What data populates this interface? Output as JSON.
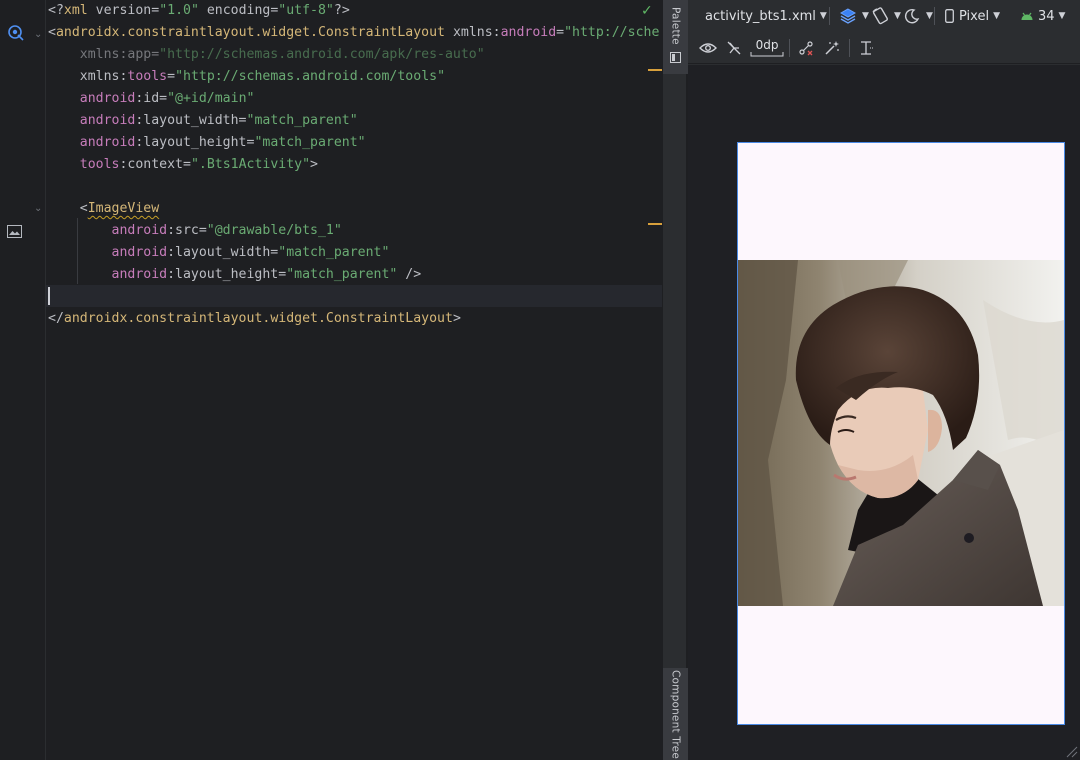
{
  "editor": {
    "lines": [
      {
        "segments": [
          [
            "punct",
            "<?"
          ],
          [
            "tag",
            "xml"
          ],
          [
            "attr",
            " version="
          ],
          [
            "str",
            "\"1.0\""
          ],
          [
            "attr",
            " encoding="
          ],
          [
            "str",
            "\"utf-8\""
          ],
          [
            "punct",
            "?>"
          ]
        ]
      },
      {
        "segments": [
          [
            "punct",
            "<"
          ],
          [
            "tag",
            "androidx.constraintlayout.widget.ConstraintLayout"
          ],
          [
            "attr",
            " xmlns:"
          ],
          [
            "ns",
            "android"
          ],
          [
            "attr",
            "="
          ],
          [
            "str",
            "\"http://sche"
          ]
        ]
      },
      {
        "segments": [
          [
            "attr",
            "    xmlns:app="
          ],
          [
            "str",
            "\"http://schemas.android.com/apk/res-auto\""
          ]
        ],
        "dim": true
      },
      {
        "segments": [
          [
            "attr",
            "    xmlns:"
          ],
          [
            "ns",
            "tools"
          ],
          [
            "attr",
            "="
          ],
          [
            "str",
            "\"http://schemas.android.com/tools\""
          ]
        ]
      },
      {
        "segments": [
          [
            "ns",
            "    android"
          ],
          [
            "attr",
            ":id="
          ],
          [
            "str",
            "\"@+id/main\""
          ]
        ]
      },
      {
        "segments": [
          [
            "ns",
            "    android"
          ],
          [
            "attr",
            ":layout_width="
          ],
          [
            "str",
            "\"match_parent\""
          ]
        ]
      },
      {
        "segments": [
          [
            "ns",
            "    android"
          ],
          [
            "attr",
            ":layout_height="
          ],
          [
            "str",
            "\"match_parent\""
          ]
        ]
      },
      {
        "segments": [
          [
            "ns",
            "    tools"
          ],
          [
            "attr",
            ":context="
          ],
          [
            "str",
            "\".Bts1Activity\""
          ],
          [
            "punct",
            ">"
          ]
        ]
      },
      {
        "segments": []
      },
      {
        "segments": [
          [
            "punct",
            "    <"
          ],
          [
            "tag-squiggle",
            "ImageView"
          ]
        ]
      },
      {
        "segments": [
          [
            "ns",
            "        android"
          ],
          [
            "attr",
            ":src="
          ],
          [
            "str",
            "\"@drawable/bts_1\""
          ]
        ]
      },
      {
        "segments": [
          [
            "ns",
            "        android"
          ],
          [
            "attr",
            ":layout_width="
          ],
          [
            "str",
            "\"match_parent\""
          ]
        ]
      },
      {
        "segments": [
          [
            "ns",
            "        android"
          ],
          [
            "attr",
            ":layout_height="
          ],
          [
            "str",
            "\"match_parent\""
          ],
          [
            "punct",
            " />"
          ]
        ]
      },
      {
        "segments": []
      },
      {
        "segments": [
          [
            "punct",
            "</"
          ],
          [
            "tag",
            "androidx.constraintlayout.widget.ConstraintLayout"
          ],
          [
            "punct",
            ">"
          ]
        ]
      }
    ]
  },
  "side_strip": {
    "palette_label": "Palette",
    "component_tree_label": "Component Tree"
  },
  "design_toolbar": {
    "file_name": "activity_bts1.xml",
    "device": "Pixel",
    "api_level": "34",
    "margin_value": "0dp"
  },
  "icons": {
    "toolbar1": [
      "file-dropdown-chevron-icon",
      "design-surface-icon",
      "orientation-icon",
      "night-mode-icon",
      "device-icon",
      "api-android-icon"
    ],
    "toolbar2": [
      "view-options-eye-icon",
      "autoconnect-off-icon",
      "default-margins-icon",
      "clear-constraints-icon",
      "infer-constraints-icon",
      "guidelines-icon"
    ]
  },
  "colors": {
    "accent_blue": "#4a8ae5",
    "tag": "#d5b778",
    "string": "#6aab73",
    "namespace": "#c77dbb",
    "check": "#5fb865"
  }
}
